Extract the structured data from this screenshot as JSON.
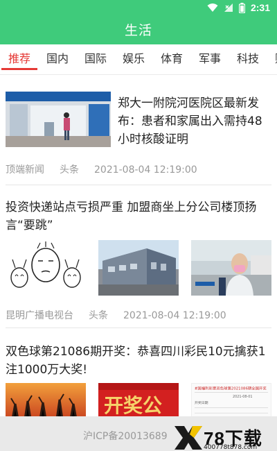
{
  "status": {
    "time": "2:31"
  },
  "header": {
    "title": "生活"
  },
  "tabs": [
    {
      "label": "推荐"
    },
    {
      "label": "国内"
    },
    {
      "label": "国际"
    },
    {
      "label": "娱乐"
    },
    {
      "label": "体育"
    },
    {
      "label": "军事"
    },
    {
      "label": "科技"
    },
    {
      "label": "财"
    }
  ],
  "feed": [
    {
      "title": "郑大一附院河医院区最新发布：患者和家属出入需持48小时核酸证明",
      "source": "顶端新闻",
      "tag": "头条",
      "time": "2021-08-04 12:19:00"
    },
    {
      "title": "投资快递站点亏损严重 加盟商坐上分公司楼顶扬言“要跳”",
      "source": "昆明广播电视台",
      "tag": "头条",
      "time": "2021-08-04 12:19:00"
    },
    {
      "title": "双色球第21086期开奖：恭喜四川彩民10元擒获1注1000万大奖!"
    }
  ],
  "thumb_text": {
    "lottery_banner": "开奖公",
    "doc_header": "#国福利彩票双色球第2021086期全国开奖",
    "doc_line1": "2021-08-01",
    "doc_line2": "开奖日期"
  },
  "footer": {
    "icp": "沪ICP备20013689"
  },
  "watermark": {
    "text": "78下载",
    "url": "400778t878.com"
  },
  "colors": {
    "brand": "#3fcb7b",
    "active_tab": "#e53935",
    "meta": "#999999"
  }
}
